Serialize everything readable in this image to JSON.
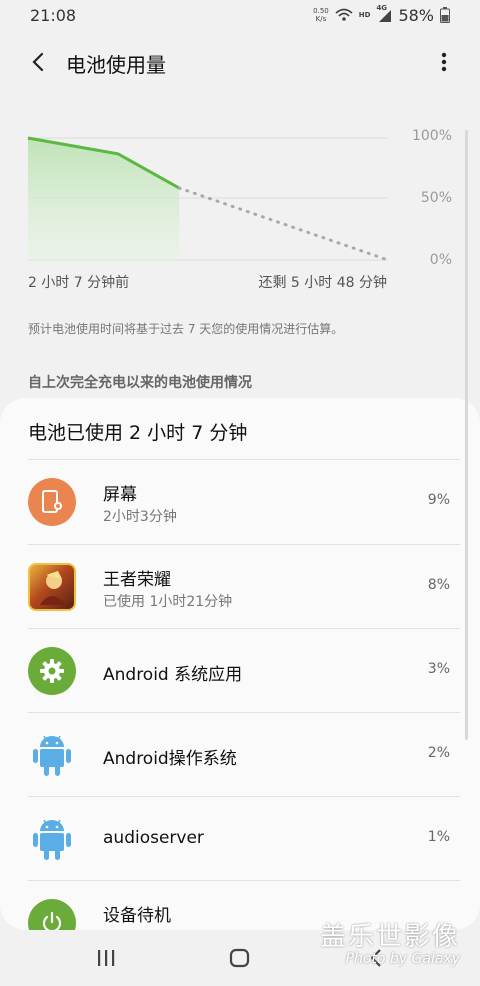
{
  "status_bar": {
    "time": "21:08",
    "net_speed_value": "0.50",
    "net_speed_unit": "K/s",
    "hd": "HD",
    "lte": "4G",
    "battery": "58%"
  },
  "header": {
    "title": "电池使用量"
  },
  "chart_data": {
    "type": "line",
    "yticks": [
      "100%",
      "50%",
      "0%"
    ],
    "ylim": [
      0,
      100
    ],
    "series": [
      {
        "x": [
          0,
          0.25,
          0.42
        ],
        "values": [
          100,
          87,
          59
        ]
      },
      {
        "x": [
          0.42,
          1.0
        ],
        "values": [
          59,
          0
        ],
        "style": "dotted-prediction"
      }
    ]
  },
  "chart_labels": {
    "start": "2 小时 7 分钟前",
    "end": "还剩 5 小时 48 分钟"
  },
  "note": "预计电池使用时间将基于过去 7 天您的使用情况进行估算。",
  "section_header": "自上次完全充电以来的电池使用情况",
  "card": {
    "title": "电池已使用 2 小时 7 分钟",
    "apps": [
      {
        "name": "屏幕",
        "sub": "2小时3分钟",
        "pct": "9%",
        "icon": "screen-icon",
        "color": "#ea8550"
      },
      {
        "name": "王者荣耀",
        "sub": "已使用 1小时21分钟",
        "pct": "8%",
        "icon": "honor-of-kings-icon"
      },
      {
        "name": "Android 系统应用",
        "sub": "",
        "pct": "3%",
        "icon": "gear-icon",
        "color": "#6aab3a"
      },
      {
        "name": "Android操作系统",
        "sub": "",
        "pct": "2%",
        "icon": "android-icon",
        "color": "#5aaee5"
      },
      {
        "name": "audioserver",
        "sub": "",
        "pct": "1%",
        "icon": "android-icon",
        "color": "#5aaee5"
      },
      {
        "name": "设备待机",
        "sub": "",
        "pct": "",
        "icon": "power-icon",
        "color": "#6aab3a"
      }
    ]
  },
  "watermark": {
    "line1": "盖乐世影像",
    "line2": "Photo by Galaxy"
  }
}
